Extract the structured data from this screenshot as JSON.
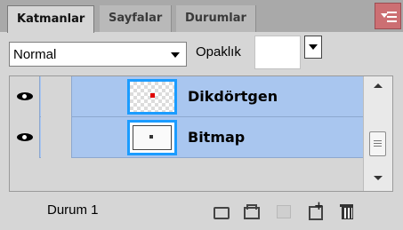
{
  "tabs": [
    {
      "label": "Katmanlar",
      "active": true
    },
    {
      "label": "Sayfalar",
      "active": false
    },
    {
      "label": "Durumlar",
      "active": false
    }
  ],
  "menu_button_icon": "panel-menu-icon",
  "accent_color": "#a9c6ef",
  "thumbnail_border_color": "#1b9cff",
  "blend_mode": {
    "value": "Normal",
    "icon": "chevron-down-icon"
  },
  "opacity": {
    "label": "Opaklık",
    "value": ""
  },
  "layers": [
    {
      "name": "Dikdörtgen",
      "visible": true,
      "selected": true,
      "thumbnail": "red-dot-on-transparent"
    },
    {
      "name": "Bitmap",
      "visible": true,
      "selected": true,
      "thumbnail": "bitmap-frame"
    }
  ],
  "footer": {
    "status": "Durum 1",
    "tools": [
      "link-layers-icon",
      "new-group-icon",
      "add-mask-icon",
      "new-layer-icon",
      "delete-icon"
    ]
  }
}
